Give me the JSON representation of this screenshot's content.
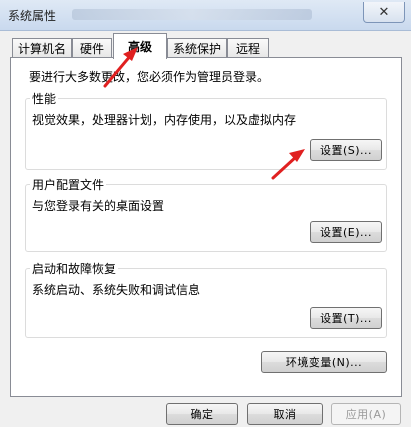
{
  "window": {
    "title": "系统属性",
    "close_glyph": "✕"
  },
  "tabs": [
    {
      "label": "计算机名"
    },
    {
      "label": "硬件"
    },
    {
      "label": "高级"
    },
    {
      "label": "系统保护"
    },
    {
      "label": "远程"
    }
  ],
  "panel": {
    "intro": "要进行大多数更改，您必须作为管理员登录。",
    "groups": [
      {
        "title": "性能",
        "desc": "视觉效果，处理器计划，内存使用，以及虚拟内存",
        "button": "设置(S)..."
      },
      {
        "title": "用户配置文件",
        "desc": "与您登录有关的桌面设置",
        "button": "设置(E)..."
      },
      {
        "title": "启动和故障恢复",
        "desc": "系统启动、系统失败和调试信息",
        "button": "设置(T)..."
      }
    ],
    "env_button": "环境变量(N)..."
  },
  "footer": {
    "ok": "确定",
    "cancel": "取消",
    "apply": "应用(A)"
  },
  "annotations": {
    "arrow_color": "#e02020"
  }
}
